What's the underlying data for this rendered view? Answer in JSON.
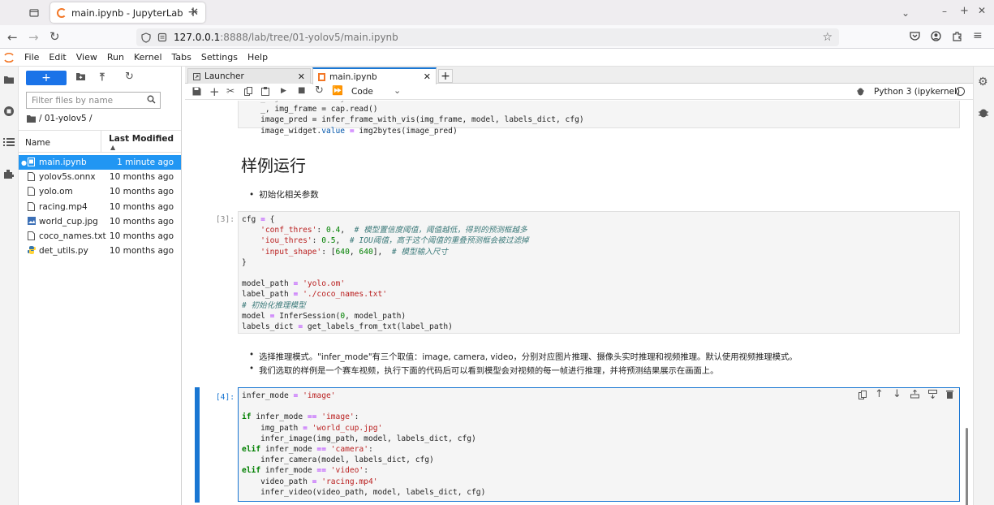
{
  "browser": {
    "tab_title": "main.ipynb - JupyterLab",
    "url_host": "127.0.0.1",
    "url_rest": ":8888/lab/tree/01-yolov5/main.ipynb"
  },
  "menu": [
    "File",
    "Edit",
    "View",
    "Run",
    "Kernel",
    "Tabs",
    "Settings",
    "Help"
  ],
  "filebrowser": {
    "new_button": "+",
    "filter_placeholder": "Filter files by name",
    "breadcrumb": "/ 01-yolov5 /",
    "col_name": "Name",
    "col_modified": "Last Modified",
    "files": [
      {
        "name": "main.ipynb",
        "modified": "1 minute ago"
      },
      {
        "name": "yolov5s.onnx",
        "modified": "10 months ago"
      },
      {
        "name": "yolo.om",
        "modified": "10 months ago"
      },
      {
        "name": "racing.mp4",
        "modified": "10 months ago"
      },
      {
        "name": "world_cup.jpg",
        "modified": "10 months ago"
      },
      {
        "name": "coco_names.txt",
        "modified": "10 months ago"
      },
      {
        "name": "det_utils.py",
        "modified": "10 months ago"
      }
    ]
  },
  "doc_tabs": [
    {
      "label": "Launcher"
    },
    {
      "label": "main.ipynb"
    }
  ],
  "toolbar": {
    "cell_type": "Code",
    "kernel": "Python 3 (ipykernel)"
  },
  "notebook": {
    "top_code_partial": "    _, img_frame = cap.read()",
    "heading": "样例运行",
    "bullet1": "初始化相关参数",
    "prompt3": "[3]:",
    "bullet2": "选择推理模式。\"infer_mode\"有三个取值：image, camera, video，分别对应图片推理、摄像头实时推理和视频推理。默认使用视频推理模式。",
    "bullet3": "我们选取的样例是一个赛车视频，执行下面的代码后可以看到模型会对视频的每一帧进行推理，并将预测结果展示在画面上。",
    "prompt4": "[4]:"
  },
  "colors": {
    "accent": "#1a73e8",
    "selection": "#2196f3",
    "active_cell_bar": "#1976d2"
  }
}
